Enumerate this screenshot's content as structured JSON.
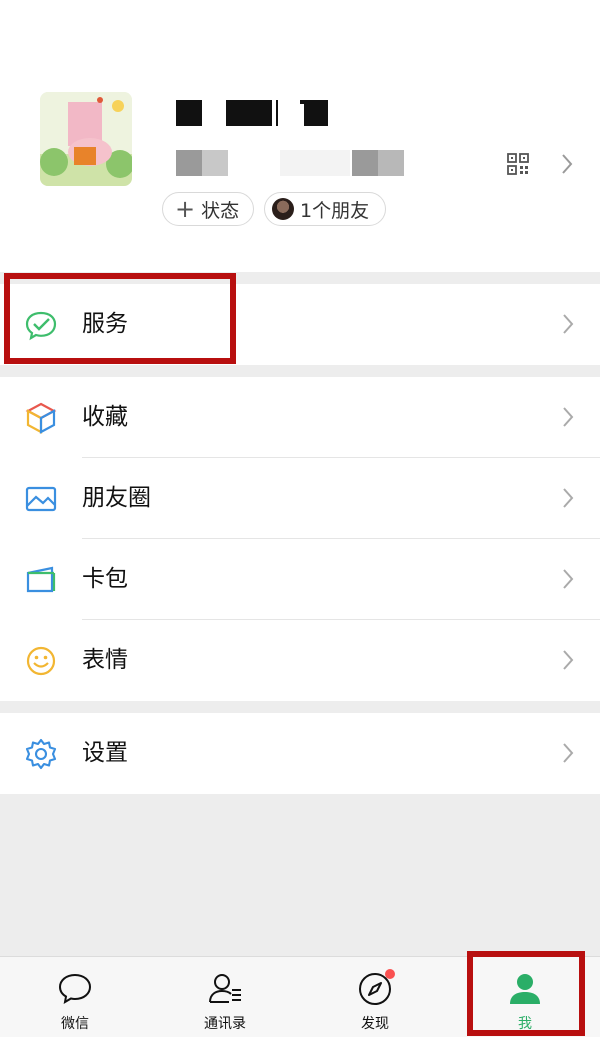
{
  "profile": {
    "status_label": "状态",
    "friends_label": "1个朋友"
  },
  "menu": {
    "services": {
      "label": "服务",
      "icon": "services-icon"
    },
    "group2": [
      {
        "label": "收藏",
        "icon": "favorites-icon"
      },
      {
        "label": "朋友圈",
        "icon": "moments-icon"
      },
      {
        "label": "卡包",
        "icon": "card-wallet-icon"
      },
      {
        "label": "表情",
        "icon": "stickers-icon"
      }
    ],
    "settings": {
      "label": "设置",
      "icon": "settings-icon"
    }
  },
  "tabs": [
    {
      "label": "微信",
      "icon": "chat-bubble-icon"
    },
    {
      "label": "通讯录",
      "icon": "contacts-icon"
    },
    {
      "label": "发现",
      "icon": "compass-icon",
      "badge": true
    },
    {
      "label": "我",
      "icon": "person-icon",
      "active": true
    }
  ],
  "colors": {
    "accent_green": "#2aae67",
    "highlight_red": "#b80f0f",
    "badge_red": "#fa5151"
  }
}
